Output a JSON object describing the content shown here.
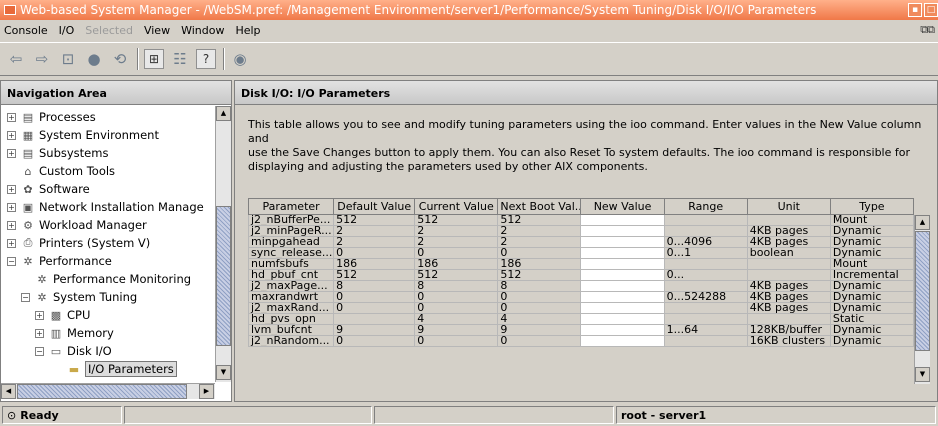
{
  "window": {
    "title": "Web-based System Manager - /WebSM.pref: /Management Environment/server1/Performance/System Tuning/Disk I/O/I/O Parameters"
  },
  "menu": [
    {
      "label": "Console",
      "disabled": false
    },
    {
      "label": "I/O",
      "disabled": false
    },
    {
      "label": "Selected",
      "disabled": true
    },
    {
      "label": "View",
      "disabled": false
    },
    {
      "label": "Window",
      "disabled": false
    },
    {
      "label": "Help",
      "disabled": false
    }
  ],
  "toolbar": {
    "icons": [
      "back-icon",
      "forward-icon",
      "up-folder-icon",
      "stop-icon",
      "find-icon",
      "tree-view-icon",
      "list-view-icon",
      "help-icon",
      "monitor-icon"
    ]
  },
  "nav": {
    "header": "Navigation Area",
    "items": [
      {
        "label": "Processes",
        "icon": "processes-icon"
      },
      {
        "label": "System Environment",
        "icon": "system-environment-icon"
      },
      {
        "label": "Subsystems",
        "icon": "subsystems-icon"
      },
      {
        "label": "Custom Tools",
        "icon": "custom-tools-icon"
      },
      {
        "label": "Software",
        "icon": "software-icon"
      },
      {
        "label": "Network Installation Manage",
        "icon": "network-installation-icon"
      },
      {
        "label": "Workload Manager",
        "icon": "workload-manager-icon"
      },
      {
        "label": "Printers (System V)",
        "icon": "printer-icon"
      },
      {
        "label": "Performance",
        "icon": "performance-icon"
      },
      {
        "label": "Performance Monitoring",
        "icon": "performance-monitoring-icon"
      },
      {
        "label": "System Tuning",
        "icon": "system-tuning-icon"
      },
      {
        "label": "CPU",
        "icon": "cpu-icon"
      },
      {
        "label": "Memory",
        "icon": "memory-icon"
      },
      {
        "label": "Disk I/O",
        "icon": "disk-icon"
      },
      {
        "label": "I/O Parameters",
        "icon": "folder-icon"
      }
    ]
  },
  "content": {
    "header": "Disk I/O: I/O Parameters",
    "description_lines": [
      "This table allows you to see and modify tuning parameters using the ioo command. Enter values in the New Value column and",
      "use the Save Changes button to apply them. You can also Reset To system defaults. The ioo command is responsible for",
      "displaying and adjusting the parameters used by other AIX components."
    ],
    "table": {
      "columns": [
        "Parameter",
        "Default Value",
        "Current Value",
        "Next Boot Val...",
        "New Value",
        "Range",
        "Unit",
        "Type"
      ],
      "rows": [
        [
          "j2_nBufferPe...",
          "512",
          "512",
          "512",
          "",
          "",
          "",
          "Mount"
        ],
        [
          "j2_minPageR...",
          "2",
          "2",
          "2",
          "",
          "",
          "4KB pages",
          "Dynamic"
        ],
        [
          "minpgahead",
          "2",
          "2",
          "2",
          "",
          "0...4096",
          "4KB pages",
          "Dynamic"
        ],
        [
          "sync_release...",
          "0",
          "0",
          "0",
          "",
          "0...1",
          "boolean",
          "Dynamic"
        ],
        [
          "numfsbufs",
          "186",
          "186",
          "186",
          "",
          "",
          "",
          "Mount"
        ],
        [
          "hd_pbuf_cnt",
          "512",
          "512",
          "512",
          "",
          "0...",
          "",
          "Incremental"
        ],
        [
          "j2_maxPage...",
          "8",
          "8",
          "8",
          "",
          "",
          "4KB pages",
          "Dynamic"
        ],
        [
          "maxrandwrt",
          "0",
          "0",
          "0",
          "",
          "0...524288",
          "4KB pages",
          "Dynamic"
        ],
        [
          "j2_maxRand...",
          "0",
          "0",
          "0",
          "",
          "",
          "4KB pages",
          "Dynamic"
        ],
        [
          "hd_pvs_opn",
          "",
          "4",
          "4",
          "",
          "",
          "",
          "Static"
        ],
        [
          "lvm_bufcnt",
          "9",
          "9",
          "9",
          "",
          "1...64",
          "128KB/buffer",
          "Dynamic"
        ],
        [
          "j2_nRandom...",
          "0",
          "0",
          "0",
          "",
          "",
          "16KB clusters",
          "Dynamic"
        ]
      ]
    }
  },
  "status": {
    "ready": "Ready",
    "user_host": "root - server1"
  }
}
